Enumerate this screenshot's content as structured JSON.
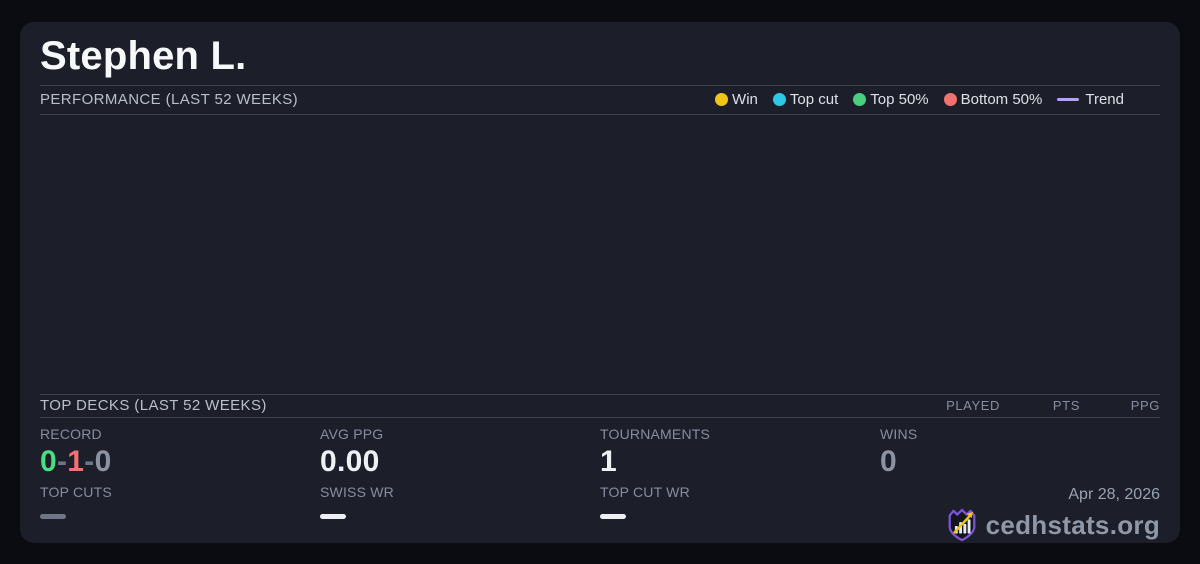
{
  "card": {
    "title": "Stephen L."
  },
  "performance_section": {
    "heading": "PERFORMANCE (LAST 52 WEEKS)",
    "legend": [
      {
        "label": "Win",
        "color": "#f0c419",
        "marker": "dot"
      },
      {
        "label": "Top cut",
        "color": "#2cc8e5",
        "marker": "dot"
      },
      {
        "label": "Top 50%",
        "color": "#49cf7e",
        "marker": "dot"
      },
      {
        "label": "Bottom 50%",
        "color": "#f27171",
        "marker": "dot"
      },
      {
        "label": "Trend",
        "color": "#b5a3f2",
        "marker": "line"
      }
    ],
    "chart_data": {
      "type": "scatter",
      "points": []
    }
  },
  "top_decks_section": {
    "heading": "TOP DECKS (LAST 52 WEEKS)",
    "columns": [
      "PLAYED",
      "PTS",
      "PPG"
    ],
    "rows": []
  },
  "stats": {
    "record": {
      "label": "RECORD",
      "wins": "0",
      "sep": "-",
      "losses": "1",
      "draws": "0"
    },
    "avg_ppg": {
      "label": "AVG PPG",
      "value": "0.00"
    },
    "tournaments": {
      "label": "TOURNAMENTS",
      "value": "1"
    },
    "wins": {
      "label": "WINS",
      "value": "0"
    },
    "top_cuts": {
      "label": "TOP CUTS",
      "value": "—"
    },
    "swiss_wr": {
      "label": "SWISS WR",
      "value": "—"
    },
    "top_cut_wr": {
      "label": "TOP CUT WR",
      "value": "—"
    }
  },
  "footer": {
    "date": "Apr 28, 2026",
    "brand": "cedhstats.org"
  },
  "colors": {
    "page_bg": "#0b0c11",
    "card_bg": "#1c1f2a",
    "divider": "#3a4150",
    "win_green": "#4ade80",
    "loss_red": "#f47171",
    "draw_gray": "#8b93a3",
    "sep_gray": "#6e7586",
    "value_white": "#eef0f4",
    "value_gray": "#8b93a3",
    "dash_muted": "#6e7586",
    "dash_white": "#eef0f4",
    "logo_purple": "#7d53d8",
    "logo_gold": "#f0c419"
  }
}
